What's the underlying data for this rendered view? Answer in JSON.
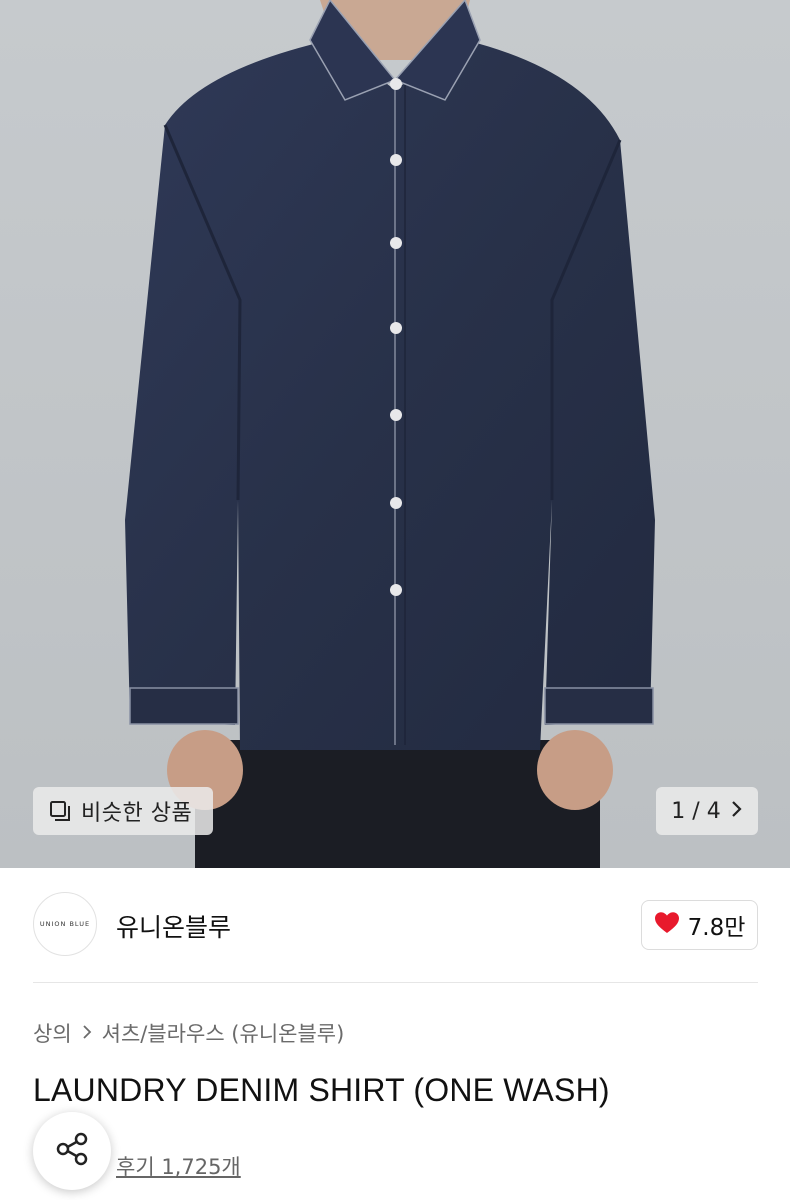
{
  "gallery": {
    "similar_button_label": "비슷한 상품",
    "counter": "1 / 4"
  },
  "brand": {
    "logo_text": "UNION BLUE",
    "name": "유니온블루",
    "likes": "7.8만"
  },
  "breadcrumb": {
    "level1": "상의",
    "level2": "셔츠/블라우스 (유니온블루)"
  },
  "product": {
    "title": "LAUNDRY DENIM SHIRT (ONE WASH)",
    "reviews": "후기 1,725개"
  },
  "colors": {
    "heart": "#e8192c",
    "denim": "#2a3350",
    "background": "#c2c6c9"
  },
  "icons": {
    "similar": "copy-icon",
    "next": "chevron-right-icon",
    "like": "heart-icon",
    "share": "share-icon"
  }
}
